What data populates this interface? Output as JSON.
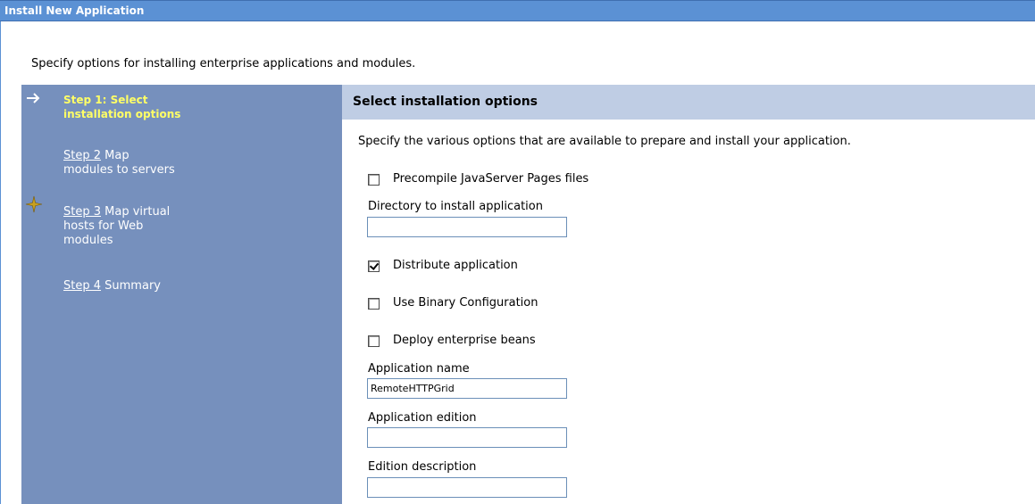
{
  "window": {
    "title": "Install New Application"
  },
  "page": {
    "description": "Specify options for installing enterprise applications and modules."
  },
  "wizard_nav": {
    "current_step": "Step 1: Select installation options",
    "current_step_line1": "Step 1: Select",
    "current_step_line2": "installation options",
    "steps": [
      {
        "link": "Step 2",
        "text_line1": "Map",
        "text_line2": "modules to servers"
      },
      {
        "link": "Step 3",
        "text_line1": "Map virtual",
        "text_line2": "hosts for Web",
        "text_line3": "modules"
      },
      {
        "link": "Step 4",
        "text_line1": "Summary"
      }
    ],
    "icons": {
      "current": "arrow-right-icon",
      "attention": "star-icon"
    },
    "colors": {
      "nav_bg": "#7690bd",
      "current_text": "#ffff66",
      "title_bar": "#5b91d4",
      "header_bg": "#bfcde4"
    }
  },
  "section": {
    "title": "Select installation options",
    "instructions": "Specify the various options that are available to prepare and install your application."
  },
  "options": {
    "precompile_jsp": {
      "label": "Precompile JavaServer Pages files",
      "checked": false
    },
    "install_directory": {
      "label": "Directory to install application",
      "value": ""
    },
    "distribute": {
      "label": "Distribute application",
      "checked": true
    },
    "binary_config": {
      "label": "Use Binary Configuration",
      "checked": false
    },
    "deploy_ejb": {
      "label": "Deploy enterprise beans",
      "checked": false
    },
    "app_name": {
      "label": "Application name",
      "value": "RemoteHTTPGrid"
    },
    "app_edition": {
      "label": "Application edition",
      "value": ""
    },
    "edition_description": {
      "label": "Edition description",
      "value": ""
    }
  }
}
